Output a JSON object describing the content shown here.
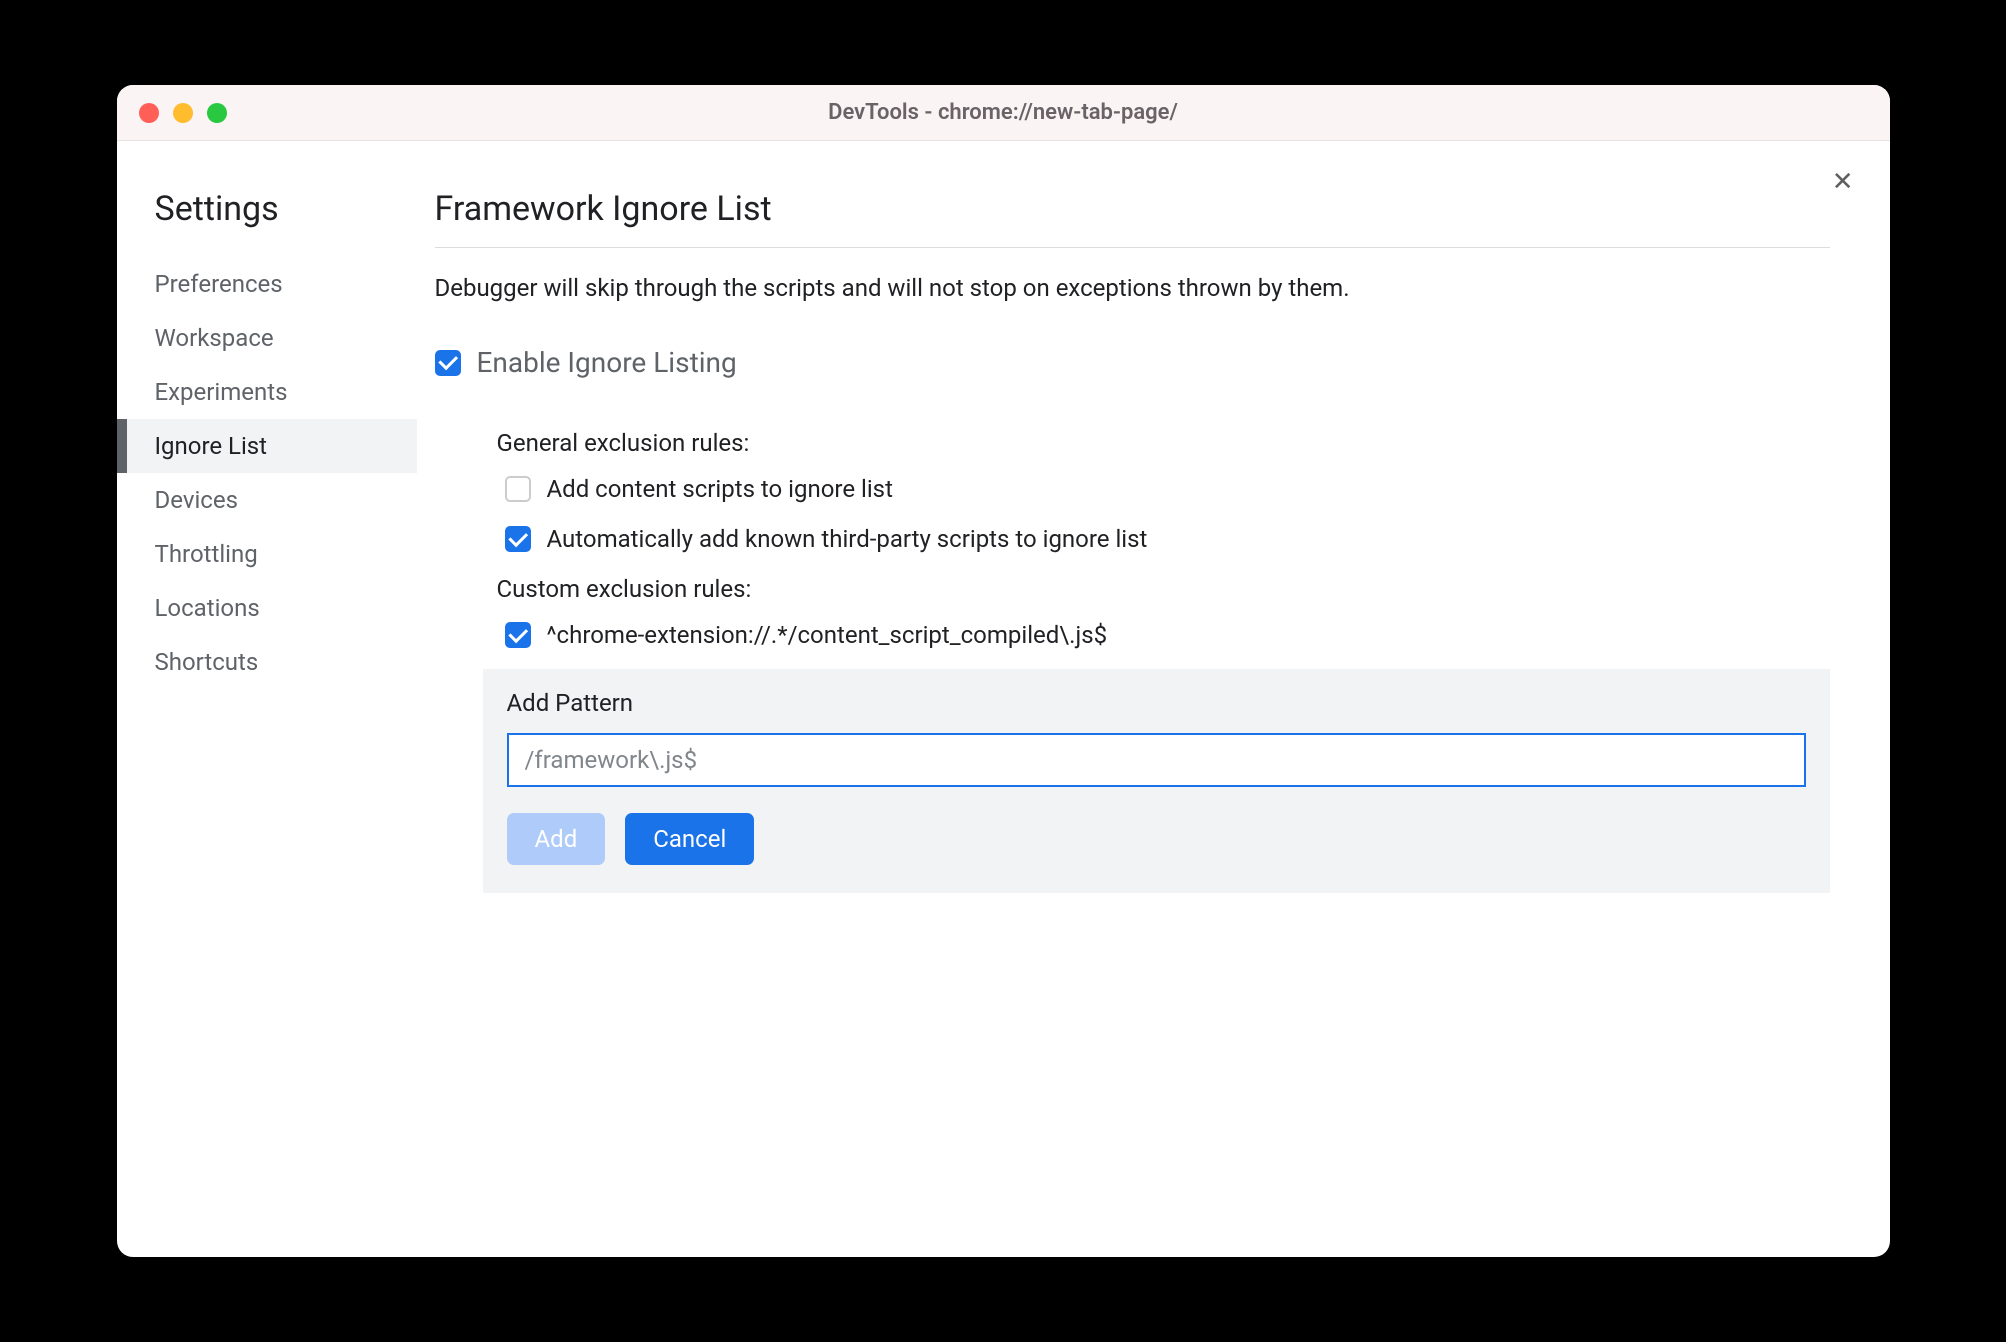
{
  "window": {
    "title": "DevTools - chrome://new-tab-page/"
  },
  "sidebar": {
    "title": "Settings",
    "items": [
      {
        "label": "Preferences",
        "active": false
      },
      {
        "label": "Workspace",
        "active": false
      },
      {
        "label": "Experiments",
        "active": false
      },
      {
        "label": "Ignore List",
        "active": true
      },
      {
        "label": "Devices",
        "active": false
      },
      {
        "label": "Throttling",
        "active": false
      },
      {
        "label": "Locations",
        "active": false
      },
      {
        "label": "Shortcuts",
        "active": false
      }
    ]
  },
  "main": {
    "title": "Framework Ignore List",
    "description": "Debugger will skip through the scripts and will not stop on exceptions thrown by them.",
    "enable_label": "Enable Ignore Listing",
    "enable_checked": true,
    "general_rules_label": "General exclusion rules:",
    "general_rules": [
      {
        "label": "Add content scripts to ignore list",
        "checked": false
      },
      {
        "label": "Automatically add known third-party scripts to ignore list",
        "checked": true
      }
    ],
    "custom_rules_label": "Custom exclusion rules:",
    "custom_rules": [
      {
        "label": "^chrome-extension://.*/content_script_compiled\\.js$",
        "checked": true
      }
    ],
    "add_pattern": {
      "label": "Add Pattern",
      "placeholder": "/framework\\.js$",
      "add_button": "Add",
      "cancel_button": "Cancel"
    }
  }
}
